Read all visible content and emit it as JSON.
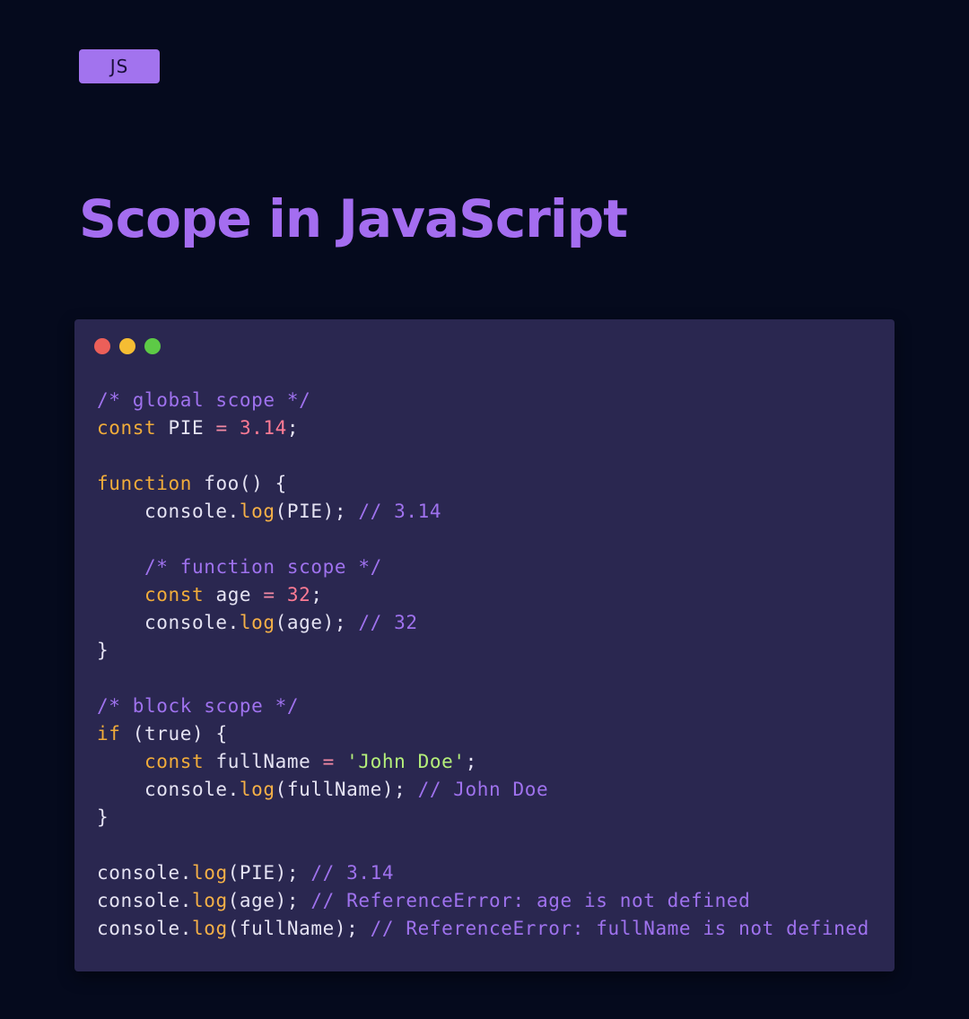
{
  "badge": {
    "label": "JS"
  },
  "title": "Scope in JavaScript",
  "window": {
    "dots": [
      {
        "name": "close",
        "color": "#ec5f59"
      },
      {
        "name": "minimize",
        "color": "#f5bd33"
      },
      {
        "name": "maximize",
        "color": "#5dca46"
      }
    ]
  },
  "code": {
    "lines": [
      [
        {
          "t": "comment",
          "v": "/* global scope */"
        }
      ],
      [
        {
          "t": "keyword",
          "v": "const"
        },
        {
          "t": "plain",
          "v": " PIE "
        },
        {
          "t": "op",
          "v": "="
        },
        {
          "t": "plain",
          "v": " "
        },
        {
          "t": "number",
          "v": "3.14"
        },
        {
          "t": "plain",
          "v": ";"
        }
      ],
      [],
      [
        {
          "t": "keyword",
          "v": "function"
        },
        {
          "t": "plain",
          "v": " foo() {"
        }
      ],
      [
        {
          "t": "plain",
          "v": "    console."
        },
        {
          "t": "method",
          "v": "log"
        },
        {
          "t": "plain",
          "v": "(PIE); "
        },
        {
          "t": "comment",
          "v": "// 3.14"
        }
      ],
      [],
      [
        {
          "t": "plain",
          "v": "    "
        },
        {
          "t": "comment",
          "v": "/* function scope */"
        }
      ],
      [
        {
          "t": "plain",
          "v": "    "
        },
        {
          "t": "keyword",
          "v": "const"
        },
        {
          "t": "plain",
          "v": " age "
        },
        {
          "t": "op",
          "v": "="
        },
        {
          "t": "plain",
          "v": " "
        },
        {
          "t": "number",
          "v": "32"
        },
        {
          "t": "plain",
          "v": ";"
        }
      ],
      [
        {
          "t": "plain",
          "v": "    console."
        },
        {
          "t": "method",
          "v": "log"
        },
        {
          "t": "plain",
          "v": "(age); "
        },
        {
          "t": "comment",
          "v": "// 32"
        }
      ],
      [
        {
          "t": "plain",
          "v": "}"
        }
      ],
      [],
      [
        {
          "t": "comment",
          "v": "/* block scope */"
        }
      ],
      [
        {
          "t": "keyword",
          "v": "if"
        },
        {
          "t": "plain",
          "v": " (true) {"
        }
      ],
      [
        {
          "t": "plain",
          "v": "    "
        },
        {
          "t": "keyword",
          "v": "const"
        },
        {
          "t": "plain",
          "v": " fullName "
        },
        {
          "t": "op",
          "v": "="
        },
        {
          "t": "plain",
          "v": " "
        },
        {
          "t": "string",
          "v": "'John Doe'"
        },
        {
          "t": "plain",
          "v": ";"
        }
      ],
      [
        {
          "t": "plain",
          "v": "    console."
        },
        {
          "t": "method",
          "v": "log"
        },
        {
          "t": "plain",
          "v": "(fullName); "
        },
        {
          "t": "comment",
          "v": "// John Doe"
        }
      ],
      [
        {
          "t": "plain",
          "v": "}"
        }
      ],
      [],
      [
        {
          "t": "plain",
          "v": "console."
        },
        {
          "t": "method",
          "v": "log"
        },
        {
          "t": "plain",
          "v": "(PIE); "
        },
        {
          "t": "comment",
          "v": "// 3.14"
        }
      ],
      [
        {
          "t": "plain",
          "v": "console."
        },
        {
          "t": "method",
          "v": "log"
        },
        {
          "t": "plain",
          "v": "(age); "
        },
        {
          "t": "comment",
          "v": "// ReferenceError: age is not defined"
        }
      ],
      [
        {
          "t": "plain",
          "v": "console."
        },
        {
          "t": "method",
          "v": "log"
        },
        {
          "t": "plain",
          "v": "(fullName); "
        },
        {
          "t": "comment",
          "v": "// ReferenceError: fullName is not defined"
        }
      ]
    ]
  }
}
